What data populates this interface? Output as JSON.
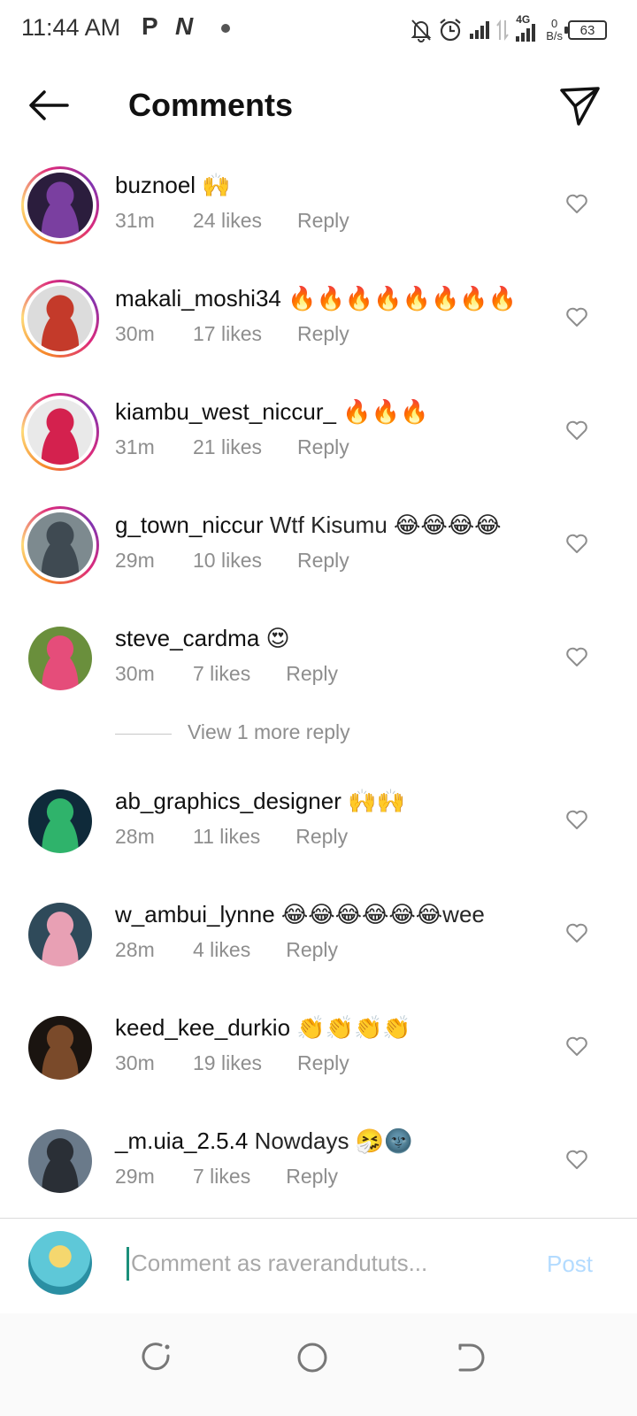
{
  "status_bar": {
    "time": "11:44 AM",
    "icon_p": "P",
    "icon_n": "N",
    "network_type": "4G",
    "net_speed_value": "0",
    "net_speed_unit": "B/s",
    "battery": "63"
  },
  "header": {
    "title": "Comments"
  },
  "comments": [
    {
      "user": "buznoel",
      "text": "🙌",
      "time": "31m",
      "likes": "24 likes",
      "reply": "Reply",
      "avatar_colors": [
        "#2b1d3d",
        "#7a3fa0"
      ],
      "story_ring": true
    },
    {
      "user": "makali_moshi34",
      "text": "🔥🔥🔥🔥🔥🔥🔥🔥",
      "time": "30m",
      "likes": "17 likes",
      "reply": "Reply",
      "avatar_colors": [
        "#dcdcdc",
        "#c43a2a"
      ],
      "story_ring": true
    },
    {
      "user": "kiambu_west_niccur_",
      "text": "🔥🔥🔥",
      "time": "31m",
      "likes": "21 likes",
      "reply": "Reply",
      "avatar_colors": [
        "#e9e9e9",
        "#d4214e"
      ],
      "story_ring": true
    },
    {
      "user": "g_town_niccur",
      "text": "Wtf Kisumu 😂😂😂😂",
      "time": "29m",
      "likes": "10 likes",
      "reply": "Reply",
      "avatar_colors": [
        "#7d8a8f",
        "#3f4a52"
      ],
      "story_ring": true
    },
    {
      "user": "steve_cardma",
      "text": "😍",
      "time": "30m",
      "likes": "7 likes",
      "reply": "Reply",
      "avatar_colors": [
        "#6a8f3c",
        "#e54d7a"
      ],
      "story_ring": false
    }
  ],
  "view_more": "View 1 more reply",
  "comments_2": [
    {
      "user": "ab_graphics_designer",
      "text": "🙌🙌",
      "time": "28m",
      "likes": "11 likes",
      "reply": "Reply",
      "avatar_colors": [
        "#0f2a3a",
        "#2fb36b"
      ],
      "story_ring": false
    },
    {
      "user": "w_ambui_lynne",
      "text": "😂😂😂😂😂😂wee",
      "time": "28m",
      "likes": "4 likes",
      "reply": "Reply",
      "avatar_colors": [
        "#2f4a5a",
        "#e8a0b4"
      ],
      "story_ring": false
    },
    {
      "user": "keed_kee_durkio",
      "text": "👏👏👏👏",
      "time": "30m",
      "likes": "19 likes",
      "reply": "Reply",
      "avatar_colors": [
        "#1a1410",
        "#7a4a2a"
      ],
      "story_ring": false
    },
    {
      "user": "_m.uia_2.5.4",
      "text": "Nowdays 🤧🌚",
      "time": "29m",
      "likes": "7 likes",
      "reply": "Reply",
      "avatar_colors": [
        "#6a7a8a",
        "#2a2f36"
      ],
      "story_ring": false
    }
  ],
  "composer": {
    "placeholder": "Comment as raverandututs...",
    "post_label": "Post"
  },
  "colors": {
    "story_gradient": [
      "#f58529",
      "#dd2a7b",
      "#8134af"
    ],
    "meta_text": "#8e8e8e",
    "post_disabled": "#b3dbff"
  },
  "icons": {
    "back": "arrow-left-icon",
    "send": "paper-plane-icon",
    "heart": "heart-outline-icon",
    "nav_recent": "recent-apps-icon",
    "nav_home": "home-circle-icon",
    "nav_back": "nav-back-icon"
  }
}
